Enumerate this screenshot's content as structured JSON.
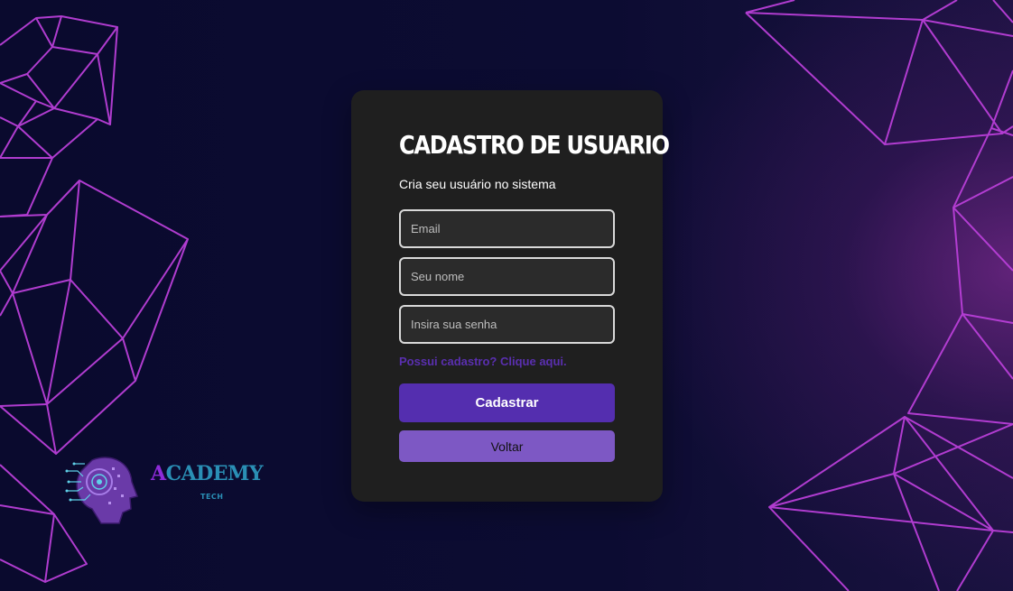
{
  "form": {
    "title": "CADASTRO DE USUARIO",
    "subtitle": "Cria seu usuário no sistema",
    "email_placeholder": "Email",
    "name_placeholder": "Seu nome",
    "password_placeholder": "Insira sua senha",
    "login_link": "Possui cadastro? Clique aqui.",
    "submit_label": "Cadastrar",
    "back_label": "Voltar"
  },
  "logo": {
    "first_letter": "A",
    "rest": "CADEMY",
    "tagline": "TECH"
  },
  "colors": {
    "background": "#0a0a2a",
    "card": "#1f1f1f",
    "accent_primary": "#542eaf",
    "accent_secondary": "#7d58c4",
    "mesh_lines": "#b93fd8",
    "logo_purple": "#8e2bd9",
    "logo_teal": "#2a8fb5"
  },
  "icons": {
    "logo_icon": "robot-head-icon",
    "decoration": "polygon-mesh-decoration"
  }
}
